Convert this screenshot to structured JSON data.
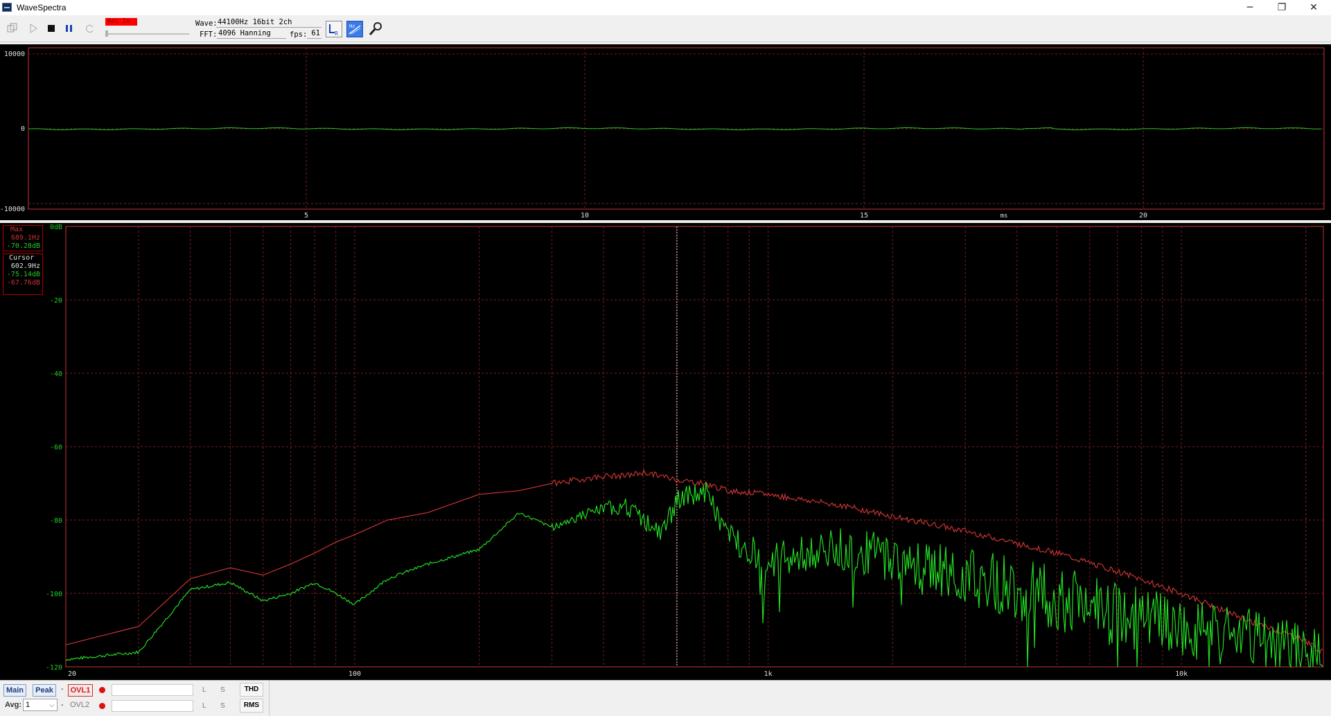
{
  "window": {
    "title": "WaveSpectra",
    "minimize_glyph": "─",
    "restore_glyph": "❐",
    "close_glyph": "✕"
  },
  "toolbar": {
    "rec_label": "Rec In",
    "wave_label": "Wave:",
    "wave_value": "44100Hz 16bit 2ch",
    "fft_label": "FFT:",
    "fft_value": "4096 Hanning",
    "fps_label": "fps:",
    "fps_value": "61",
    "icons": [
      "open-icon",
      "play-icon",
      "stop-icon",
      "pause-icon",
      "loop-icon",
      "channel-lr-icon",
      "hz-scale-icon",
      "settings-wrench-icon"
    ]
  },
  "wave_view": {
    "y_labels": [
      "10000",
      "0",
      "-10000"
    ],
    "x_labels": [
      "5",
      "10",
      "15",
      "ms",
      "20"
    ],
    "colors": {
      "frame": "#cc3333",
      "grid": "#7a1f1f",
      "trace": "#22cc22",
      "label": "#e0e0e0"
    }
  },
  "spectrum_view": {
    "y_labels": [
      "0dB",
      "-20",
      "-40",
      "-60",
      "-80",
      "-100",
      "-120"
    ],
    "x_labels": [
      "20",
      "100",
      "1k",
      "10k"
    ],
    "max_panel": {
      "title": "Max",
      "freq": "689.1Hz",
      "level": "-70.28dB"
    },
    "cursor_panel": {
      "title": "Cursor",
      "freq": "602.9Hz",
      "level_l": "-75.14dB",
      "level_r": "-67.76dB"
    },
    "colors": {
      "frame": "#cc3333",
      "grid": "#7a1f1f",
      "max_trace": "#cc3333",
      "live_trace": "#22dd22",
      "y_label": "#22cc22",
      "x_label": "#e0e0e0"
    }
  },
  "chart_data": {
    "type": "line",
    "title": "",
    "xlabel": "",
    "ylabel": "",
    "x_scale": "log",
    "xlim": [
      20,
      22050
    ],
    "ylim": [
      -120,
      0
    ],
    "grid": true,
    "series": [
      {
        "x": [
          20,
          30,
          40,
          50,
          60,
          70,
          80,
          90,
          100,
          120,
          150,
          200,
          250,
          300,
          350,
          400,
          450,
          500,
          550,
          600,
          700,
          800,
          1000,
          1500,
          2000,
          3000,
          5000,
          7000,
          10000,
          15000,
          18000,
          20000,
          22000
        ],
        "values": [
          -114,
          -109,
          -96,
          -93,
          -95,
          -92,
          -89,
          -86,
          -84,
          -80,
          -78,
          -73,
          -72,
          -70,
          -69,
          -68,
          -68,
          -67,
          -68,
          -69,
          -70,
          -72,
          -73,
          -76,
          -79,
          -83,
          -89,
          -94,
          -100,
          -108,
          -111,
          -113,
          -116
        ]
      },
      {
        "x": [
          20,
          30,
          40,
          50,
          60,
          70,
          80,
          90,
          100,
          120,
          150,
          200,
          250,
          300,
          350,
          400,
          450,
          500,
          550,
          600,
          700,
          800,
          1000,
          1500,
          2000,
          3000,
          5000,
          7000,
          10000,
          15000,
          18000,
          20000,
          22000
        ],
        "values": [
          -118,
          -116,
          -99,
          -97,
          -102,
          -100,
          -97,
          -100,
          -103,
          -96,
          -92,
          -88,
          -78,
          -82,
          -79,
          -77,
          -76,
          -80,
          -84,
          -75,
          -72,
          -84,
          -91,
          -88,
          -90,
          -95,
          -101,
          -106,
          -110,
          -113,
          -115,
          -116,
          -117
        ]
      }
    ]
  },
  "status": {
    "main_label": "Main",
    "peak_label": "Peak",
    "ovl1_label": "OVL1",
    "ovl2_label": "OVL2",
    "avg_label": "Avg:",
    "avg_value": "1",
    "dash": "-",
    "l_label": "L",
    "s_label": "S",
    "thd_label": "THD",
    "rms_label": "RMS"
  }
}
